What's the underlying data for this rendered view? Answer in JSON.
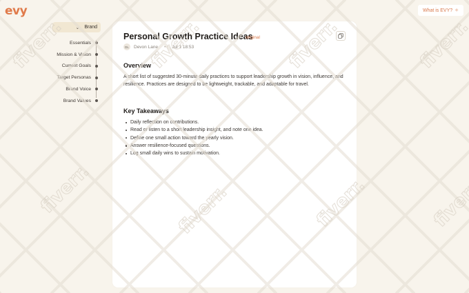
{
  "app": {
    "logo": "evy",
    "whats_button": "What is EVY?",
    "whats_icon": "sparkle-icon"
  },
  "sidebar": {
    "section_label": "Brand",
    "items": [
      {
        "label": "Essentials"
      },
      {
        "label": "Mission & Vision"
      },
      {
        "label": "Current Goals"
      },
      {
        "label": "Target Personas"
      },
      {
        "label": "Brand Voice"
      },
      {
        "label": "Brand Values"
      }
    ]
  },
  "document": {
    "title": "Personal Growth Practice Ideas",
    "tag": "original",
    "author_initials": "DL",
    "author": "Devon Lane",
    "date": "Jul 1 18:53",
    "overview_heading": "Overview",
    "overview_text": "A short list of suggested 30-minute daily practices to support leadership growth in vision, influence, and resilience. Practices are designed to be lightweight, trackable, and adaptable for travel.",
    "takeaways_heading": "Key Takeaways",
    "takeaways": [
      "Daily reflection on contributions.",
      "Read or listen to a short leadership insight, and note one idea.",
      "Define one small action toward the yearly vision.",
      "Answer resilience-focused questions.",
      "Log small daily wins to sustain motivation."
    ]
  },
  "overlay": {
    "watermark_text": "fiverr."
  },
  "colors": {
    "background": "#f8f4ec",
    "accent": "#e07a4a",
    "card": "#ffffff"
  }
}
